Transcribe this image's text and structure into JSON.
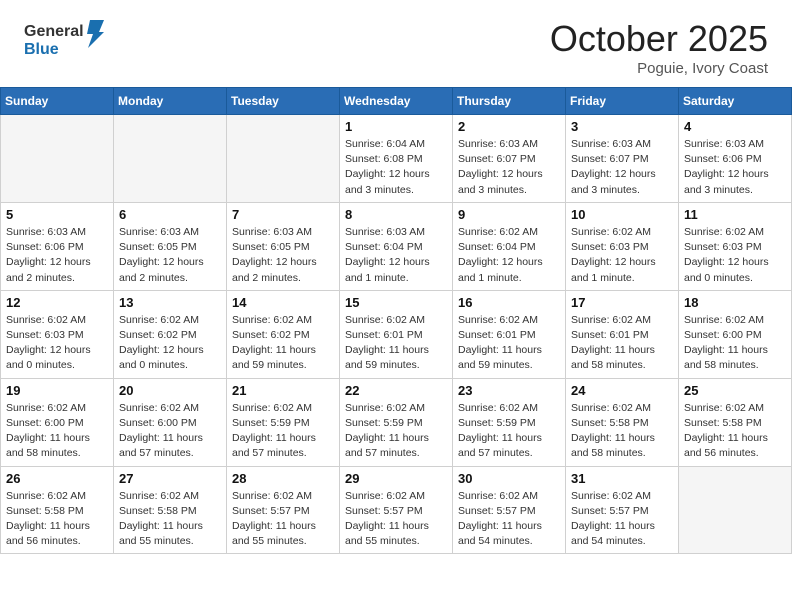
{
  "logo": {
    "general": "General",
    "blue": "Blue"
  },
  "title": {
    "month": "October 2025",
    "location": "Poguie, Ivory Coast"
  },
  "weekdays": [
    "Sunday",
    "Monday",
    "Tuesday",
    "Wednesday",
    "Thursday",
    "Friday",
    "Saturday"
  ],
  "weeks": [
    [
      {
        "day": "",
        "info": ""
      },
      {
        "day": "",
        "info": ""
      },
      {
        "day": "",
        "info": ""
      },
      {
        "day": "1",
        "info": "Sunrise: 6:04 AM\nSunset: 6:08 PM\nDaylight: 12 hours\nand 3 minutes."
      },
      {
        "day": "2",
        "info": "Sunrise: 6:03 AM\nSunset: 6:07 PM\nDaylight: 12 hours\nand 3 minutes."
      },
      {
        "day": "3",
        "info": "Sunrise: 6:03 AM\nSunset: 6:07 PM\nDaylight: 12 hours\nand 3 minutes."
      },
      {
        "day": "4",
        "info": "Sunrise: 6:03 AM\nSunset: 6:06 PM\nDaylight: 12 hours\nand 3 minutes."
      }
    ],
    [
      {
        "day": "5",
        "info": "Sunrise: 6:03 AM\nSunset: 6:06 PM\nDaylight: 12 hours\nand 2 minutes."
      },
      {
        "day": "6",
        "info": "Sunrise: 6:03 AM\nSunset: 6:05 PM\nDaylight: 12 hours\nand 2 minutes."
      },
      {
        "day": "7",
        "info": "Sunrise: 6:03 AM\nSunset: 6:05 PM\nDaylight: 12 hours\nand 2 minutes."
      },
      {
        "day": "8",
        "info": "Sunrise: 6:03 AM\nSunset: 6:04 PM\nDaylight: 12 hours\nand 1 minute."
      },
      {
        "day": "9",
        "info": "Sunrise: 6:02 AM\nSunset: 6:04 PM\nDaylight: 12 hours\nand 1 minute."
      },
      {
        "day": "10",
        "info": "Sunrise: 6:02 AM\nSunset: 6:03 PM\nDaylight: 12 hours\nand 1 minute."
      },
      {
        "day": "11",
        "info": "Sunrise: 6:02 AM\nSunset: 6:03 PM\nDaylight: 12 hours\nand 0 minutes."
      }
    ],
    [
      {
        "day": "12",
        "info": "Sunrise: 6:02 AM\nSunset: 6:03 PM\nDaylight: 12 hours\nand 0 minutes."
      },
      {
        "day": "13",
        "info": "Sunrise: 6:02 AM\nSunset: 6:02 PM\nDaylight: 12 hours\nand 0 minutes."
      },
      {
        "day": "14",
        "info": "Sunrise: 6:02 AM\nSunset: 6:02 PM\nDaylight: 11 hours\nand 59 minutes."
      },
      {
        "day": "15",
        "info": "Sunrise: 6:02 AM\nSunset: 6:01 PM\nDaylight: 11 hours\nand 59 minutes."
      },
      {
        "day": "16",
        "info": "Sunrise: 6:02 AM\nSunset: 6:01 PM\nDaylight: 11 hours\nand 59 minutes."
      },
      {
        "day": "17",
        "info": "Sunrise: 6:02 AM\nSunset: 6:01 PM\nDaylight: 11 hours\nand 58 minutes."
      },
      {
        "day": "18",
        "info": "Sunrise: 6:02 AM\nSunset: 6:00 PM\nDaylight: 11 hours\nand 58 minutes."
      }
    ],
    [
      {
        "day": "19",
        "info": "Sunrise: 6:02 AM\nSunset: 6:00 PM\nDaylight: 11 hours\nand 58 minutes."
      },
      {
        "day": "20",
        "info": "Sunrise: 6:02 AM\nSunset: 6:00 PM\nDaylight: 11 hours\nand 57 minutes."
      },
      {
        "day": "21",
        "info": "Sunrise: 6:02 AM\nSunset: 5:59 PM\nDaylight: 11 hours\nand 57 minutes."
      },
      {
        "day": "22",
        "info": "Sunrise: 6:02 AM\nSunset: 5:59 PM\nDaylight: 11 hours\nand 57 minutes."
      },
      {
        "day": "23",
        "info": "Sunrise: 6:02 AM\nSunset: 5:59 PM\nDaylight: 11 hours\nand 57 minutes."
      },
      {
        "day": "24",
        "info": "Sunrise: 6:02 AM\nSunset: 5:58 PM\nDaylight: 11 hours\nand 58 minutes."
      },
      {
        "day": "25",
        "info": "Sunrise: 6:02 AM\nSunset: 5:58 PM\nDaylight: 11 hours\nand 56 minutes."
      }
    ],
    [
      {
        "day": "26",
        "info": "Sunrise: 6:02 AM\nSunset: 5:58 PM\nDaylight: 11 hours\nand 56 minutes."
      },
      {
        "day": "27",
        "info": "Sunrise: 6:02 AM\nSunset: 5:58 PM\nDaylight: 11 hours\nand 55 minutes."
      },
      {
        "day": "28",
        "info": "Sunrise: 6:02 AM\nSunset: 5:57 PM\nDaylight: 11 hours\nand 55 minutes."
      },
      {
        "day": "29",
        "info": "Sunrise: 6:02 AM\nSunset: 5:57 PM\nDaylight: 11 hours\nand 55 minutes."
      },
      {
        "day": "30",
        "info": "Sunrise: 6:02 AM\nSunset: 5:57 PM\nDaylight: 11 hours\nand 54 minutes."
      },
      {
        "day": "31",
        "info": "Sunrise: 6:02 AM\nSunset: 5:57 PM\nDaylight: 11 hours\nand 54 minutes."
      },
      {
        "day": "",
        "info": ""
      }
    ]
  ]
}
